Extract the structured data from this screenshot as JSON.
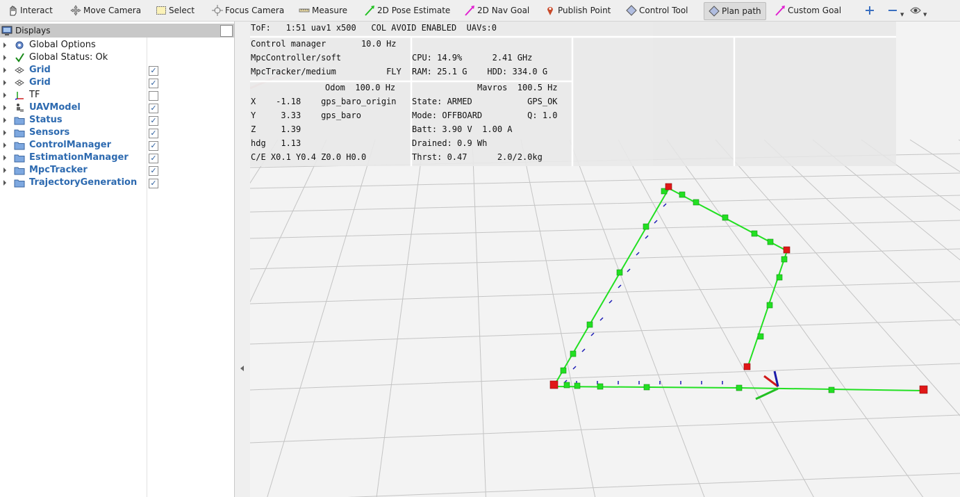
{
  "toolbar": {
    "tools": [
      {
        "label": "Interact",
        "icon": "hand-pointer-icon"
      },
      {
        "label": "Move Camera",
        "icon": "move-camera-icon"
      },
      {
        "label": "Select",
        "icon": "select-box-icon"
      },
      {
        "label": "Focus Camera",
        "icon": "focus-camera-icon"
      },
      {
        "label": "Measure",
        "icon": "ruler-icon"
      },
      {
        "label": "2D Pose Estimate",
        "icon": "green-arrow-icon"
      },
      {
        "label": "2D Nav Goal",
        "icon": "magenta-arrow-icon"
      },
      {
        "label": "Publish Point",
        "icon": "map-pin-icon"
      },
      {
        "label": "Control Tool",
        "icon": "diamond-icon"
      },
      {
        "label": "Plan path",
        "icon": "diamond-icon"
      },
      {
        "label": "Custom Goal",
        "icon": "magenta-arrow-icon"
      }
    ],
    "active_tool": "Plan path"
  },
  "displays": {
    "title": "Displays",
    "items": [
      {
        "label": "Global Options",
        "bold": false,
        "icon": "gear-icon",
        "checked": null
      },
      {
        "label": "Global Status: Ok",
        "bold": false,
        "icon": "checkmark-icon",
        "checked": null
      },
      {
        "label": "Grid",
        "bold": true,
        "icon": "grid-icon",
        "checked": true
      },
      {
        "label": "Grid",
        "bold": true,
        "icon": "grid-icon",
        "checked": true
      },
      {
        "label": "TF",
        "bold": false,
        "icon": "tf-axes-icon",
        "checked": false
      },
      {
        "label": "UAVModel",
        "bold": true,
        "icon": "robot-model-icon",
        "checked": true
      },
      {
        "label": "Status",
        "bold": true,
        "icon": "folder-icon",
        "checked": true
      },
      {
        "label": "Sensors",
        "bold": true,
        "icon": "folder-icon",
        "checked": true
      },
      {
        "label": "ControlManager",
        "bold": true,
        "icon": "folder-icon",
        "checked": true
      },
      {
        "label": "EstimationManager",
        "bold": true,
        "icon": "folder-icon",
        "checked": true
      },
      {
        "label": "MpcTracker",
        "bold": true,
        "icon": "folder-icon",
        "checked": true
      },
      {
        "label": "TrajectoryGeneration",
        "bold": true,
        "icon": "folder-icon",
        "checked": true
      }
    ]
  },
  "hud": {
    "top_line": "ToF:   1:51 uav1 x500   COL AVOID ENABLED  UAVs:0",
    "control_manager": "Control manager       10.0 Hz",
    "controller": "MpcController/soft",
    "tracker": "MpcTracker/medium          FLY",
    "cpu": "CPU: 14.9%      2.41 GHz",
    "ram": "RAM: 25.1 G    HDD: 334.0 G",
    "odom_header": "Odom  100.0 Hz",
    "odom_rows": [
      "X    -1.18    gps_baro_origin",
      "Y     3.33    gps_baro",
      "Z     1.39",
      "hdg   1.13",
      "C/E X0.1 Y0.4 Z0.0 H0.0"
    ],
    "mavros_header": "Mavros  100.5 Hz",
    "mavros_rows": [
      "State: ARMED           GPS_OK",
      "Mode: OFFBOARD         Q: 1.0",
      "Batt: 3.90 V  1.00 A",
      "Drained: 0.9 Wh",
      "Thrst: 0.47      2.0/2.0kg"
    ]
  },
  "colors": {
    "path_green": "#22e022",
    "waypoint_red": "#e01818",
    "arrow_blue": "#1a1ab4",
    "link_blue": "#2d6ab0"
  }
}
